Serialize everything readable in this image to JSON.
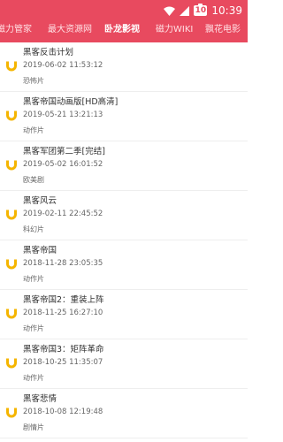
{
  "status_bar": {
    "time": "10:39",
    "battery": "10"
  },
  "tabs": [
    {
      "label": "磁力管家"
    },
    {
      "label": "最大资源网"
    },
    {
      "label": "卧龙影视",
      "active": true
    },
    {
      "label": "磁力WIKI"
    },
    {
      "label": "飘花电影"
    }
  ],
  "items": [
    {
      "title": "黑客反击计划",
      "date": "2019-06-02 11:53:12",
      "genre": "恐怖片"
    },
    {
      "title": "黑客帝国动画版[HD高清]",
      "date": "2019-05-21 13:21:13",
      "genre": "动作片"
    },
    {
      "title": "黑客军团第二季[完结]",
      "date": "2019-05-02 16:01:52",
      "genre": "欧美剧"
    },
    {
      "title": "黑客风云",
      "date": "2019-02-11 22:45:52",
      "genre": "科幻片"
    },
    {
      "title": "黑客帝国",
      "date": "2018-11-28 23:05:35",
      "genre": "动作片"
    },
    {
      "title": "黑客帝国2：重装上阵",
      "date": "2018-11-25 16:27:10",
      "genre": "动作片"
    },
    {
      "title": "黑客帝国3：矩阵革命",
      "date": "2018-10-25 11:35:07",
      "genre": "动作片"
    },
    {
      "title": "黑客悲情",
      "date": "2018-10-08 12:19:48",
      "genre": "剧情片"
    }
  ],
  "icons": {
    "wifi": "wifi-icon",
    "signal": "signal-icon",
    "battery": "battery-icon",
    "magnet": "magnet-icon"
  },
  "colors": {
    "primary": "#e84a5f",
    "magnet": "#f5b500",
    "title_text": "#333333",
    "meta_text": "#666666"
  }
}
